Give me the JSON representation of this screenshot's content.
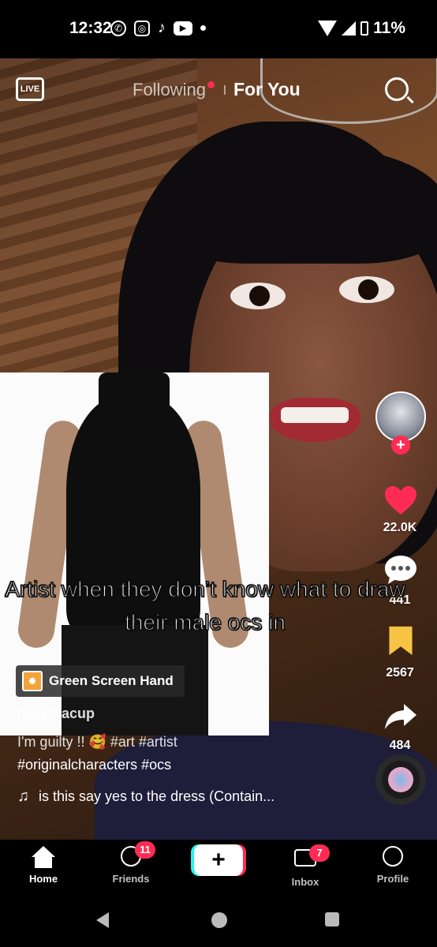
{
  "status_bar": {
    "time": "12:32",
    "battery": "11%"
  },
  "top_nav": {
    "live_label": "LIVE",
    "following": "Following",
    "for_you": "For You"
  },
  "video": {
    "overlay_text": "Artist when they don’t know what to draw their male ocs in",
    "effect_label": "Green Screen Hand",
    "username": "hazyteacup",
    "description_line1": "I'm guilty !! 🥰 #art #artist",
    "description_line2": "#originalcharacters #ocs",
    "sound": "is this say yes to the dress (Contain..."
  },
  "rail": {
    "likes": "22.0K",
    "comments": "441",
    "saves": "2567",
    "shares": "484",
    "follow_symbol": "+"
  },
  "bottom_nav": {
    "home": "Home",
    "friends": "Friends",
    "friends_badge": "11",
    "create_symbol": "+",
    "inbox": "Inbox",
    "inbox_badge": "7",
    "profile": "Profile"
  },
  "colors": {
    "accent": "#fe2c55",
    "cyan": "#25f4ee",
    "bookmark": "#f6c343"
  }
}
